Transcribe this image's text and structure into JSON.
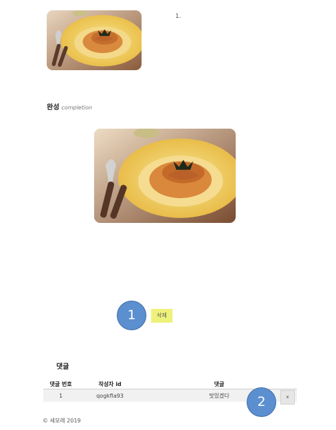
{
  "step": {
    "number": "1."
  },
  "completion": {
    "title": "완성",
    "subtitle": "completion"
  },
  "actions": {
    "delete_label": "삭제"
  },
  "annotations": [
    {
      "label": "1"
    },
    {
      "label": "2"
    }
  ],
  "comments": {
    "title": "댓글",
    "columns": [
      "댓글 번호",
      "작성자 id",
      "댓글"
    ],
    "rows": [
      {
        "no": "1",
        "author": "qogkfla93",
        "text": "맛있겠다",
        "delete_label": "x"
      }
    ]
  },
  "footer": {
    "text": "© 세모레 2019"
  }
}
